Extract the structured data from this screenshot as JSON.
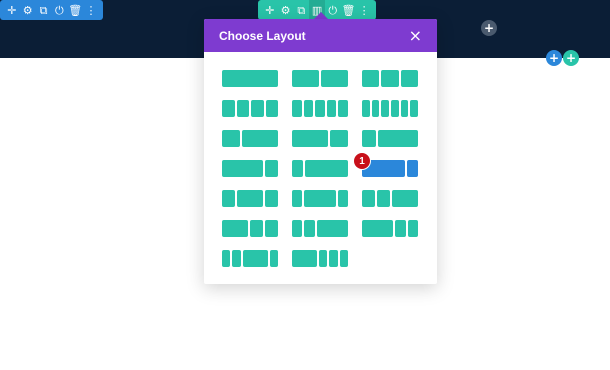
{
  "section_toolbar": {
    "icons": [
      {
        "name": "move-icon",
        "glyph": "✛"
      },
      {
        "name": "gear-icon",
        "glyph": "⚙"
      },
      {
        "name": "duplicate-icon",
        "glyph": "⧉"
      },
      {
        "name": "power-icon",
        "glyph": "⏻"
      },
      {
        "name": "trash-icon",
        "glyph": "🗑"
      },
      {
        "name": "more-icon",
        "glyph": "⋮"
      }
    ]
  },
  "row_toolbar": {
    "icons": [
      {
        "name": "move-icon",
        "glyph": "✛"
      },
      {
        "name": "gear-icon",
        "glyph": "⚙"
      },
      {
        "name": "duplicate-icon",
        "glyph": "⧉"
      },
      {
        "name": "columns-icon",
        "glyph": "▥"
      },
      {
        "name": "power-icon",
        "glyph": "⏻"
      },
      {
        "name": "trash-icon",
        "glyph": "🗑"
      },
      {
        "name": "more-icon",
        "glyph": "⋮"
      }
    ]
  },
  "buttons": {
    "add_module_glyph": "+",
    "add_row_glyph": "+",
    "add_section_glyph": "+"
  },
  "modal": {
    "title": "Choose Layout",
    "close_glyph": "×"
  },
  "layouts": [
    [
      [
        1
      ],
      [
        1,
        1
      ],
      [
        1,
        1,
        1
      ]
    ],
    [
      [
        1,
        1,
        1,
        1
      ],
      [
        1,
        1,
        1,
        1,
        1
      ],
      [
        1,
        1,
        1,
        1,
        1,
        1
      ]
    ],
    [
      [
        1,
        2
      ],
      [
        2,
        1
      ],
      [
        1,
        3
      ]
    ],
    [
      [
        3,
        1
      ],
      [
        1,
        4
      ],
      [
        4,
        1
      ]
    ],
    [
      [
        1,
        2,
        1
      ],
      [
        1,
        3,
        1
      ],
      [
        1,
        1,
        2
      ]
    ],
    [
      [
        2,
        1,
        1
      ],
      [
        1,
        1,
        3
      ],
      [
        3,
        1,
        1
      ]
    ],
    [
      [
        1,
        1,
        3,
        1
      ],
      [
        3,
        1,
        1,
        1
      ]
    ]
  ],
  "selected_layout": {
    "row": 3,
    "col": 2
  },
  "badge": {
    "text": "1"
  },
  "colors": {
    "header_band": "#0b1e36",
    "section_toolbar": "#2b87da",
    "row_toolbar": "#29c4a9",
    "modal_header": "#7e3bd0",
    "layout_option": "#29c4a9",
    "layout_selected": "#2b87da",
    "badge": "#c8101a"
  }
}
